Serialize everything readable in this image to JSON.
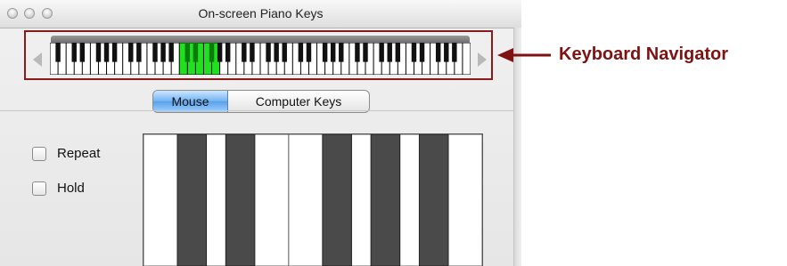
{
  "window": {
    "title": "On-screen Piano Keys"
  },
  "navigator": {
    "callout_label": "Keyboard Navigator",
    "highlight_color": "#20e020",
    "highlight_start_white_key": 16,
    "highlight_white_key_count": 5
  },
  "mode_selector": {
    "options": [
      "Mouse",
      "Computer Keys"
    ],
    "selected": "Mouse"
  },
  "options": {
    "repeat_label": "Repeat",
    "hold_label": "Hold",
    "repeat_checked": false,
    "hold_checked": false
  },
  "colors": {
    "callout": "#7f1111",
    "active_segment": "#6fb2f2"
  },
  "icons": {
    "close": "close-button-icon",
    "minimize": "minimize-button-icon",
    "zoom": "zoom-button-icon",
    "scroll_left": "scroll-left-arrow-icon",
    "scroll_right": "scroll-right-arrow-icon",
    "callout": "callout-arrow-icon"
  }
}
